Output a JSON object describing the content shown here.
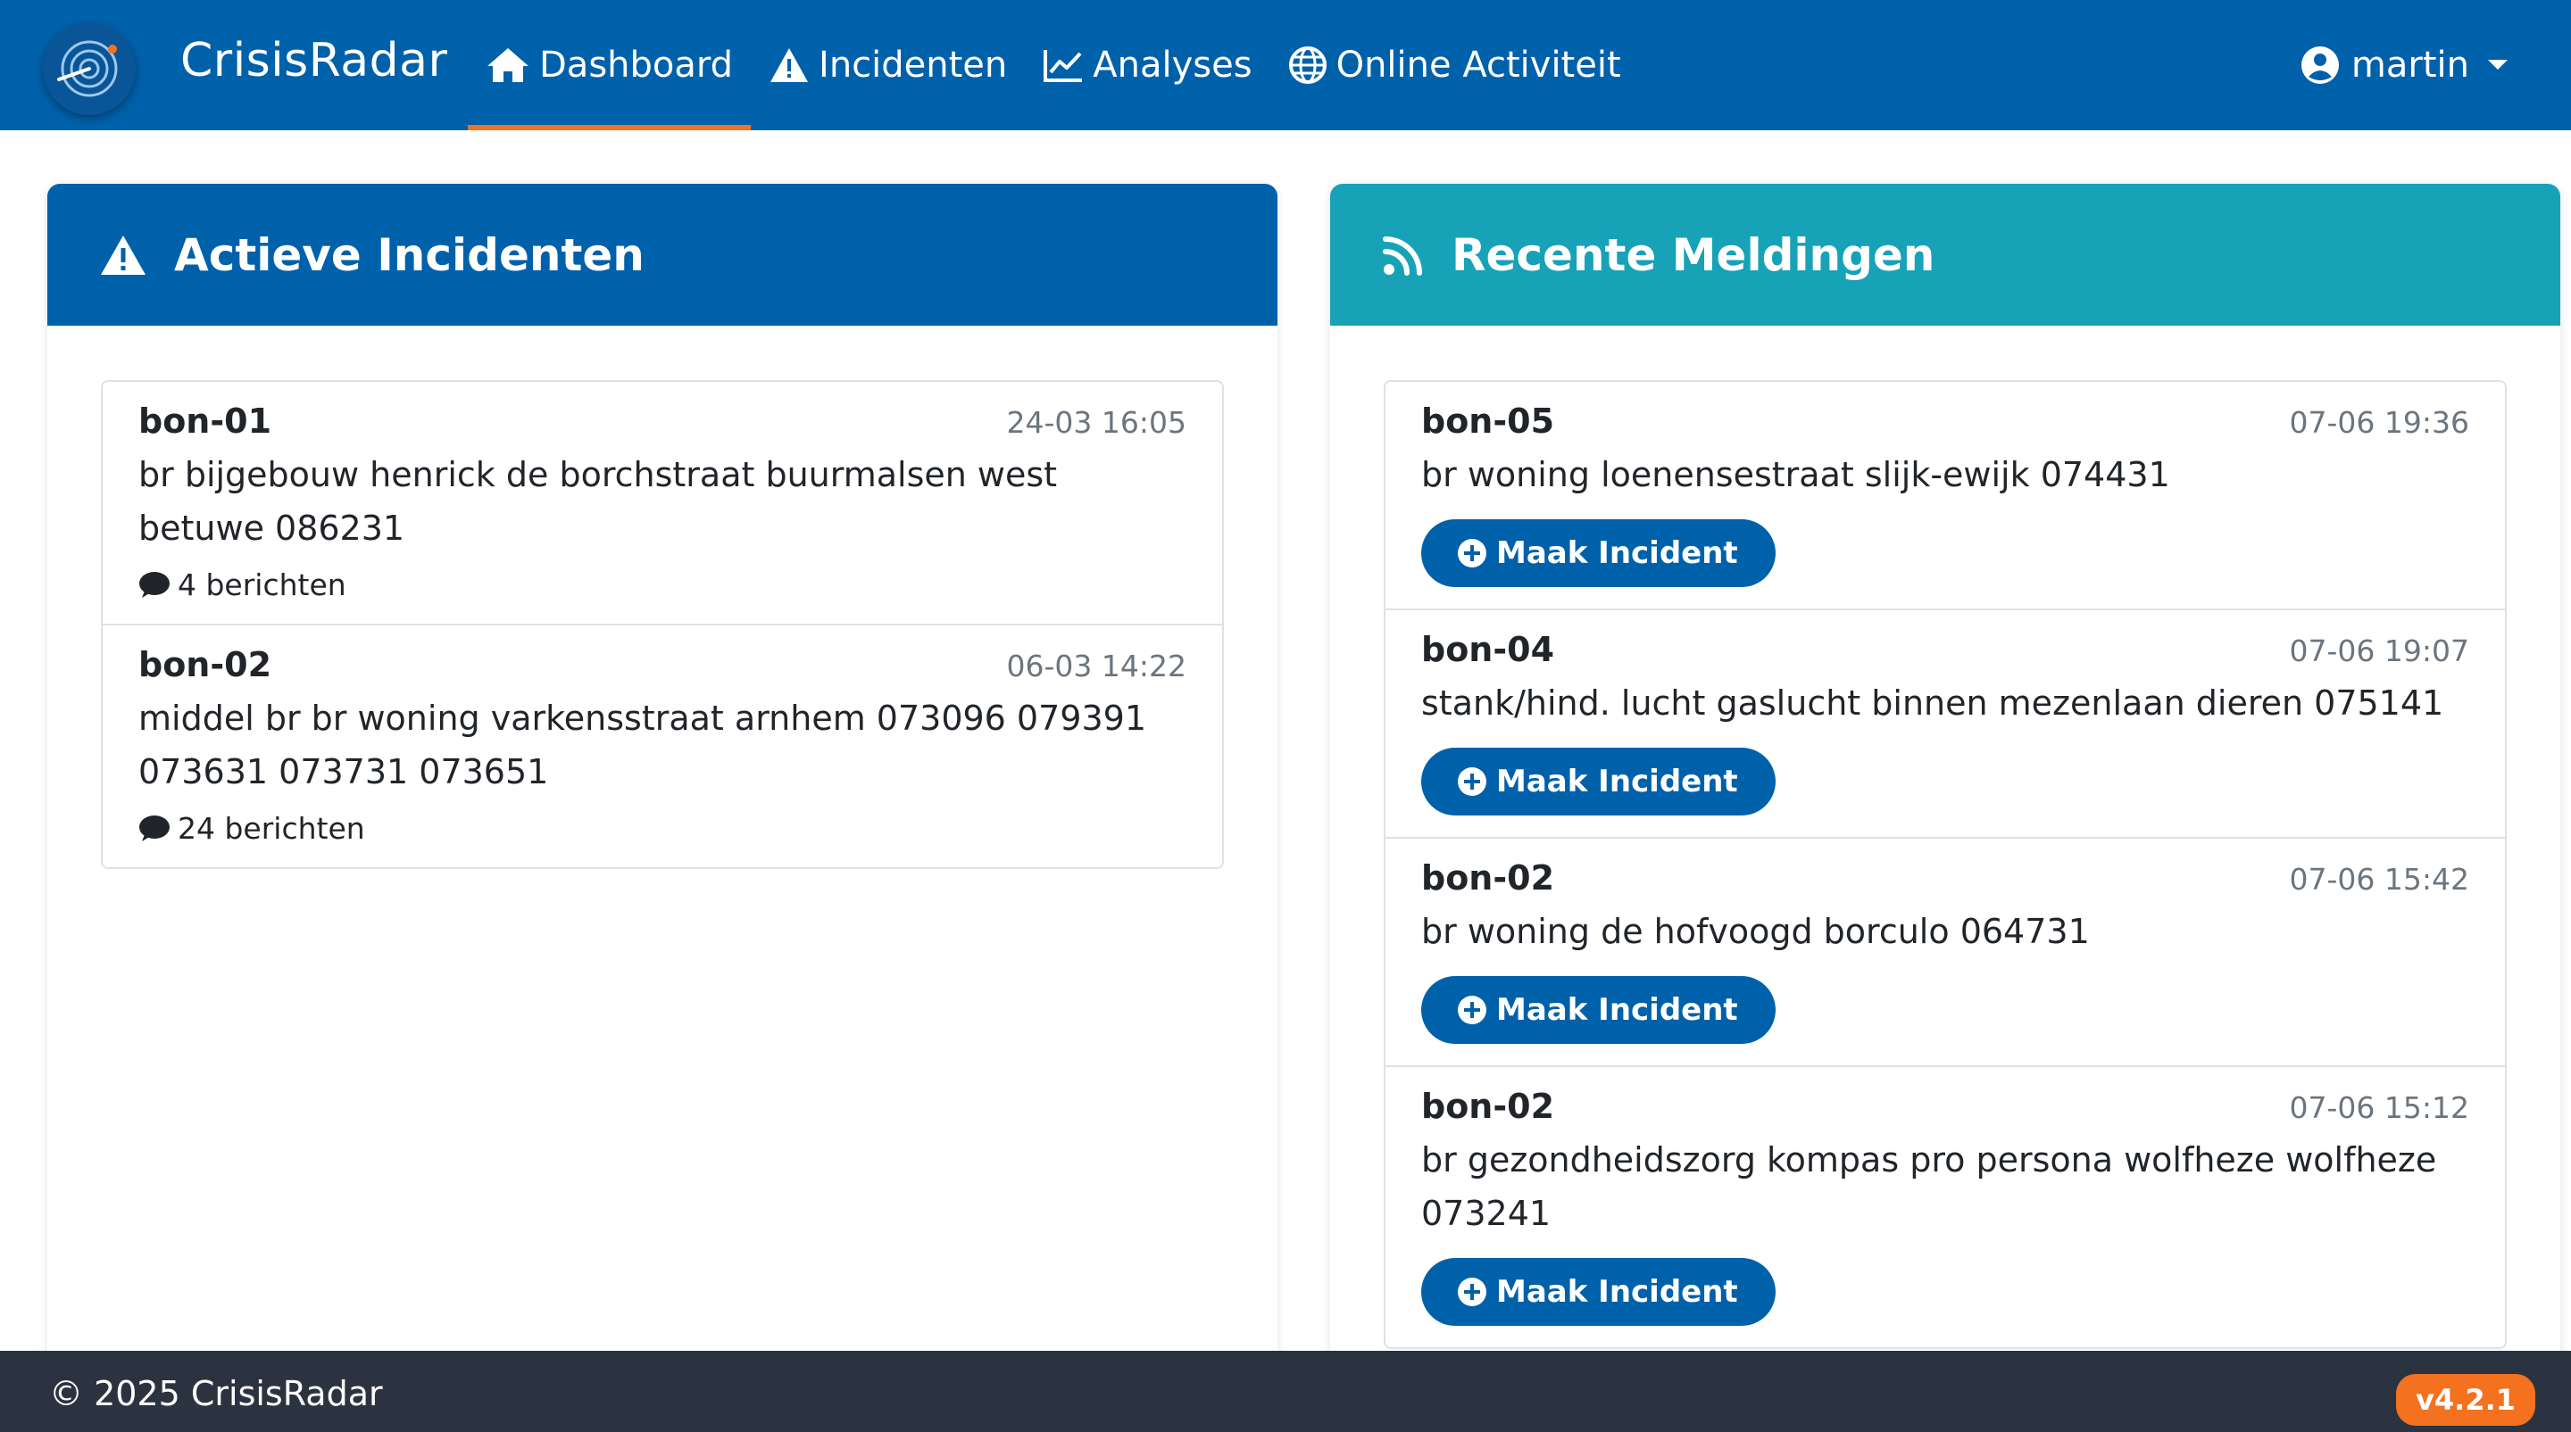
{
  "app": {
    "brand": "CrisisRadar"
  },
  "nav": {
    "items": [
      {
        "label": "Dashboard",
        "icon": "home-icon",
        "active": true
      },
      {
        "label": "Incidenten",
        "icon": "warning-icon"
      },
      {
        "label": "Analyses",
        "icon": "chart-line-icon"
      },
      {
        "label": "Online Activiteit",
        "icon": "globe-icon"
      }
    ],
    "user": "martin"
  },
  "incidents": {
    "title": "Actieve Incidenten",
    "items": [
      {
        "id": "bon-01",
        "time": "24-03 16:05",
        "text": "br bijgebouw henrick de borchstraat buurmalsen west betuwe 086231",
        "messages": "4 berichten"
      },
      {
        "id": "bon-02",
        "time": "06-03 14:22",
        "text": "middel br br woning varkensstraat arnhem 073096 079391 073631 073731 073651",
        "messages": "24 berichten"
      }
    ]
  },
  "reports": {
    "title": "Recente Meldingen",
    "button_label": "Maak Incident",
    "items": [
      {
        "id": "bon-05",
        "time": "07-06 19:36",
        "text": "br woning loenensestraat slijk-ewijk 074431"
      },
      {
        "id": "bon-04",
        "time": "07-06 19:07",
        "text": "stank/hind. lucht gaslucht binnen mezenlaan dieren 075141"
      },
      {
        "id": "bon-02",
        "time": "07-06 15:42",
        "text": "br woning de hofvoogd borculo 064731"
      },
      {
        "id": "bon-02",
        "time": "07-06 15:12",
        "text": "br gezondheidszorg kompas pro persona wolfheze wolfheze 073241"
      }
    ]
  },
  "footer": {
    "copyright": "© 2025 CrisisRadar",
    "version": "v4.2.1"
  },
  "colors": {
    "primary": "#0061ab",
    "info": "#17a2b8",
    "accent": "#f4711f",
    "footer": "#2b3340"
  }
}
